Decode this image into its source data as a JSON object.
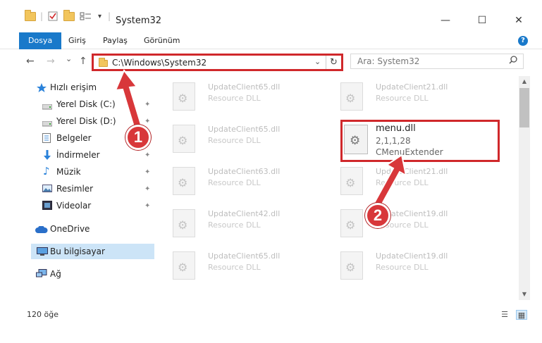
{
  "window": {
    "title": "System32",
    "minimize": "—",
    "maximize": "☐",
    "close": "✕"
  },
  "ribbon": {
    "tabs": [
      "Dosya",
      "Giriş",
      "Paylaş",
      "Görünüm"
    ],
    "active_tab": "Dosya",
    "help": "?"
  },
  "nav": {
    "back": "←",
    "forward": "→",
    "recent": "⌄",
    "up": "↑",
    "address": "C:\\Windows\\System32",
    "dropdown": "⌄",
    "refresh": "↻",
    "search_placeholder": "Ara: System32",
    "search_icon": "⚲"
  },
  "sidebar": {
    "quick_access": "Hızlı erişim",
    "items": [
      {
        "label": "Yerel Disk (C:)",
        "icon": "drive-icon",
        "pinned": true
      },
      {
        "label": "Yerel Disk (D:)",
        "icon": "drive-icon",
        "pinned": true
      },
      {
        "label": "Belgeler",
        "icon": "documents-icon",
        "pinned": true
      },
      {
        "label": "İndirmeler",
        "icon": "downloads-icon",
        "pinned": true
      },
      {
        "label": "Müzik",
        "icon": "music-icon",
        "pinned": true
      },
      {
        "label": "Resimler",
        "icon": "pictures-icon",
        "pinned": true
      },
      {
        "label": "Videolar",
        "icon": "videos-icon",
        "pinned": true
      }
    ],
    "onedrive": "OneDrive",
    "this_pc": "Bu bilgisayar",
    "network": "Ağ",
    "pin_glyph": "📌"
  },
  "files": [
    {
      "name": "UpdateClient65.dll",
      "desc": "Resource DLL"
    },
    {
      "name": "UpdateClient21.dll",
      "desc": "Resource DLL"
    },
    {
      "name": "UpdateClient65.dll",
      "desc": "Resource DLL"
    },
    {
      "name": "UpdateClient63.dll",
      "desc": "Resource DLL"
    },
    {
      "name": "UpdateClient21.dll",
      "desc": "Resource DLL"
    },
    {
      "name": "UpdateClient42.dll",
      "desc": "Resource DLL"
    },
    {
      "name": "UpdateClient19.dll",
      "desc": "Resource DLL"
    },
    {
      "name": "UpdateClient65.dll",
      "desc": "Resource DLL"
    },
    {
      "name": "UpdateClient19.dll",
      "desc": "Resource DLL"
    }
  ],
  "highlighted_file": {
    "name": "menu.dll",
    "version": "2,1,1,28",
    "description": "CMenuExtender"
  },
  "status": {
    "count": "120 öğe",
    "details_view": "☰",
    "icons_view": "▦"
  },
  "annotations": {
    "step1": "1",
    "step2": "2",
    "color": "#d0282b"
  }
}
